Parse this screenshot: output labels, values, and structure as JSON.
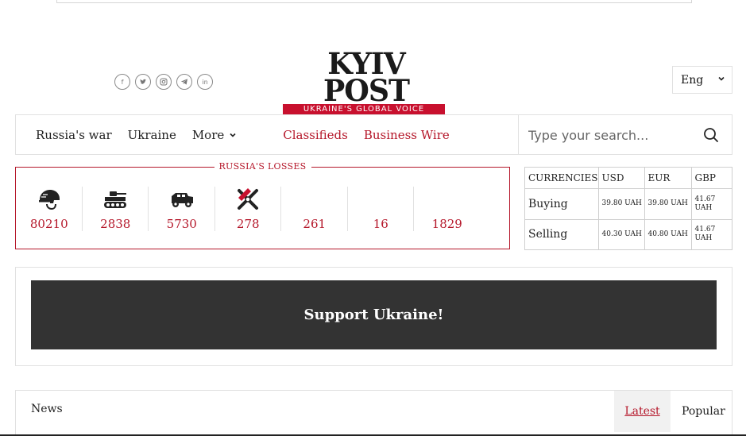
{
  "header": {
    "socials": [
      {
        "icon": "facebook-icon",
        "glyph": "f"
      },
      {
        "icon": "twitter-icon",
        "glyph": ""
      },
      {
        "icon": "instagram-icon",
        "glyph": ""
      },
      {
        "icon": "telegram-icon",
        "glyph": ""
      },
      {
        "icon": "linkedin-icon",
        "glyph": "in"
      }
    ],
    "logo_text": "KYIV POST",
    "logo_tagline": "UKRAINE'S GLOBAL VOICE",
    "language": "Eng"
  },
  "nav": {
    "items": [
      "Russia's war",
      "Ukraine"
    ],
    "more_label": "More",
    "red_items": [
      "Classifieds",
      "Business Wire"
    ],
    "search_placeholder": "Type your search..."
  },
  "losses": {
    "title": "RUSSIA'S LOSSES",
    "items": [
      {
        "icon": "helmet-icon",
        "value": "80210"
      },
      {
        "icon": "tank-icon",
        "value": "2838"
      },
      {
        "icon": "armored-vehicle-icon",
        "value": "5730"
      },
      {
        "icon": "artillery-icon",
        "value": "278"
      },
      {
        "icon": "",
        "value": "261"
      },
      {
        "icon": "",
        "value": "16"
      },
      {
        "icon": "",
        "value": "1829"
      }
    ]
  },
  "currency": {
    "headers": [
      "CURRENCIES",
      "USD",
      "EUR",
      "GBP"
    ],
    "rows": [
      {
        "label": "Buying",
        "usd": "39.80 UAH",
        "eur": "39.80 UAH",
        "gbp": "41.67 UAH"
      },
      {
        "label": "Selling",
        "usd": "40.30 UAH",
        "eur": "40.80 UAH",
        "gbp": "41.67 UAH"
      }
    ]
  },
  "support": {
    "label": "Support Ukraine!"
  },
  "news": {
    "label": "News",
    "tabs": [
      "Latest",
      "Popular"
    ]
  },
  "colors": {
    "accent": "#b5172a",
    "logo_red": "#c8102e",
    "support_bg": "#333333"
  }
}
